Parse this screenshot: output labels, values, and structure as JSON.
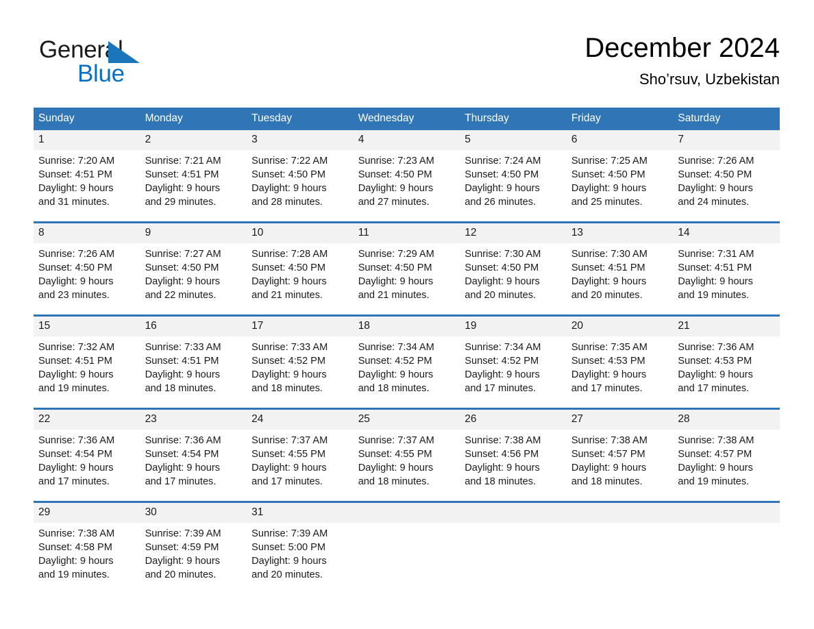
{
  "brand": {
    "name_part1": "General",
    "name_part2": "Blue",
    "triangle_color": "#1b75bb",
    "blue_text_color": "#0a70c0"
  },
  "header": {
    "title": "December 2024",
    "subtitle": "Sho’rsuv, Uzbekistan"
  },
  "theme": {
    "header_blue": "#3075b5",
    "separator_blue": "#3075b5",
    "daynum_band": "#f2f2f2",
    "text": "#1a1a1a"
  },
  "weekday_headers": [
    "Sunday",
    "Monday",
    "Tuesday",
    "Wednesday",
    "Thursday",
    "Friday",
    "Saturday"
  ],
  "weeks": [
    {
      "days": [
        {
          "date": "1",
          "sunrise": "Sunrise: 7:20 AM",
          "sunset": "Sunset: 4:51 PM",
          "daylight1": "Daylight: 9 hours",
          "daylight2": "and 31 minutes."
        },
        {
          "date": "2",
          "sunrise": "Sunrise: 7:21 AM",
          "sunset": "Sunset: 4:51 PM",
          "daylight1": "Daylight: 9 hours",
          "daylight2": "and 29 minutes."
        },
        {
          "date": "3",
          "sunrise": "Sunrise: 7:22 AM",
          "sunset": "Sunset: 4:50 PM",
          "daylight1": "Daylight: 9 hours",
          "daylight2": "and 28 minutes."
        },
        {
          "date": "4",
          "sunrise": "Sunrise: 7:23 AM",
          "sunset": "Sunset: 4:50 PM",
          "daylight1": "Daylight: 9 hours",
          "daylight2": "and 27 minutes."
        },
        {
          "date": "5",
          "sunrise": "Sunrise: 7:24 AM",
          "sunset": "Sunset: 4:50 PM",
          "daylight1": "Daylight: 9 hours",
          "daylight2": "and 26 minutes."
        },
        {
          "date": "6",
          "sunrise": "Sunrise: 7:25 AM",
          "sunset": "Sunset: 4:50 PM",
          "daylight1": "Daylight: 9 hours",
          "daylight2": "and 25 minutes."
        },
        {
          "date": "7",
          "sunrise": "Sunrise: 7:26 AM",
          "sunset": "Sunset: 4:50 PM",
          "daylight1": "Daylight: 9 hours",
          "daylight2": "and 24 minutes."
        }
      ]
    },
    {
      "days": [
        {
          "date": "8",
          "sunrise": "Sunrise: 7:26 AM",
          "sunset": "Sunset: 4:50 PM",
          "daylight1": "Daylight: 9 hours",
          "daylight2": "and 23 minutes."
        },
        {
          "date": "9",
          "sunrise": "Sunrise: 7:27 AM",
          "sunset": "Sunset: 4:50 PM",
          "daylight1": "Daylight: 9 hours",
          "daylight2": "and 22 minutes."
        },
        {
          "date": "10",
          "sunrise": "Sunrise: 7:28 AM",
          "sunset": "Sunset: 4:50 PM",
          "daylight1": "Daylight: 9 hours",
          "daylight2": "and 21 minutes."
        },
        {
          "date": "11",
          "sunrise": "Sunrise: 7:29 AM",
          "sunset": "Sunset: 4:50 PM",
          "daylight1": "Daylight: 9 hours",
          "daylight2": "and 21 minutes."
        },
        {
          "date": "12",
          "sunrise": "Sunrise: 7:30 AM",
          "sunset": "Sunset: 4:50 PM",
          "daylight1": "Daylight: 9 hours",
          "daylight2": "and 20 minutes."
        },
        {
          "date": "13",
          "sunrise": "Sunrise: 7:30 AM",
          "sunset": "Sunset: 4:51 PM",
          "daylight1": "Daylight: 9 hours",
          "daylight2": "and 20 minutes."
        },
        {
          "date": "14",
          "sunrise": "Sunrise: 7:31 AM",
          "sunset": "Sunset: 4:51 PM",
          "daylight1": "Daylight: 9 hours",
          "daylight2": "and 19 minutes."
        }
      ]
    },
    {
      "days": [
        {
          "date": "15",
          "sunrise": "Sunrise: 7:32 AM",
          "sunset": "Sunset: 4:51 PM",
          "daylight1": "Daylight: 9 hours",
          "daylight2": "and 19 minutes."
        },
        {
          "date": "16",
          "sunrise": "Sunrise: 7:33 AM",
          "sunset": "Sunset: 4:51 PM",
          "daylight1": "Daylight: 9 hours",
          "daylight2": "and 18 minutes."
        },
        {
          "date": "17",
          "sunrise": "Sunrise: 7:33 AM",
          "sunset": "Sunset: 4:52 PM",
          "daylight1": "Daylight: 9 hours",
          "daylight2": "and 18 minutes."
        },
        {
          "date": "18",
          "sunrise": "Sunrise: 7:34 AM",
          "sunset": "Sunset: 4:52 PM",
          "daylight1": "Daylight: 9 hours",
          "daylight2": "and 18 minutes."
        },
        {
          "date": "19",
          "sunrise": "Sunrise: 7:34 AM",
          "sunset": "Sunset: 4:52 PM",
          "daylight1": "Daylight: 9 hours",
          "daylight2": "and 17 minutes."
        },
        {
          "date": "20",
          "sunrise": "Sunrise: 7:35 AM",
          "sunset": "Sunset: 4:53 PM",
          "daylight1": "Daylight: 9 hours",
          "daylight2": "and 17 minutes."
        },
        {
          "date": "21",
          "sunrise": "Sunrise: 7:36 AM",
          "sunset": "Sunset: 4:53 PM",
          "daylight1": "Daylight: 9 hours",
          "daylight2": "and 17 minutes."
        }
      ]
    },
    {
      "days": [
        {
          "date": "22",
          "sunrise": "Sunrise: 7:36 AM",
          "sunset": "Sunset: 4:54 PM",
          "daylight1": "Daylight: 9 hours",
          "daylight2": "and 17 minutes."
        },
        {
          "date": "23",
          "sunrise": "Sunrise: 7:36 AM",
          "sunset": "Sunset: 4:54 PM",
          "daylight1": "Daylight: 9 hours",
          "daylight2": "and 17 minutes."
        },
        {
          "date": "24",
          "sunrise": "Sunrise: 7:37 AM",
          "sunset": "Sunset: 4:55 PM",
          "daylight1": "Daylight: 9 hours",
          "daylight2": "and 17 minutes."
        },
        {
          "date": "25",
          "sunrise": "Sunrise: 7:37 AM",
          "sunset": "Sunset: 4:55 PM",
          "daylight1": "Daylight: 9 hours",
          "daylight2": "and 18 minutes."
        },
        {
          "date": "26",
          "sunrise": "Sunrise: 7:38 AM",
          "sunset": "Sunset: 4:56 PM",
          "daylight1": "Daylight: 9 hours",
          "daylight2": "and 18 minutes."
        },
        {
          "date": "27",
          "sunrise": "Sunrise: 7:38 AM",
          "sunset": "Sunset: 4:57 PM",
          "daylight1": "Daylight: 9 hours",
          "daylight2": "and 18 minutes."
        },
        {
          "date": "28",
          "sunrise": "Sunrise: 7:38 AM",
          "sunset": "Sunset: 4:57 PM",
          "daylight1": "Daylight: 9 hours",
          "daylight2": "and 19 minutes."
        }
      ]
    },
    {
      "days": [
        {
          "date": "29",
          "sunrise": "Sunrise: 7:38 AM",
          "sunset": "Sunset: 4:58 PM",
          "daylight1": "Daylight: 9 hours",
          "daylight2": "and 19 minutes."
        },
        {
          "date": "30",
          "sunrise": "Sunrise: 7:39 AM",
          "sunset": "Sunset: 4:59 PM",
          "daylight1": "Daylight: 9 hours",
          "daylight2": "and 20 minutes."
        },
        {
          "date": "31",
          "sunrise": "Sunrise: 7:39 AM",
          "sunset": "Sunset: 5:00 PM",
          "daylight1": "Daylight: 9 hours",
          "daylight2": "and 20 minutes."
        },
        {
          "date": "",
          "sunrise": "",
          "sunset": "",
          "daylight1": "",
          "daylight2": ""
        },
        {
          "date": "",
          "sunrise": "",
          "sunset": "",
          "daylight1": "",
          "daylight2": ""
        },
        {
          "date": "",
          "sunrise": "",
          "sunset": "",
          "daylight1": "",
          "daylight2": ""
        },
        {
          "date": "",
          "sunrise": "",
          "sunset": "",
          "daylight1": "",
          "daylight2": ""
        }
      ]
    }
  ]
}
